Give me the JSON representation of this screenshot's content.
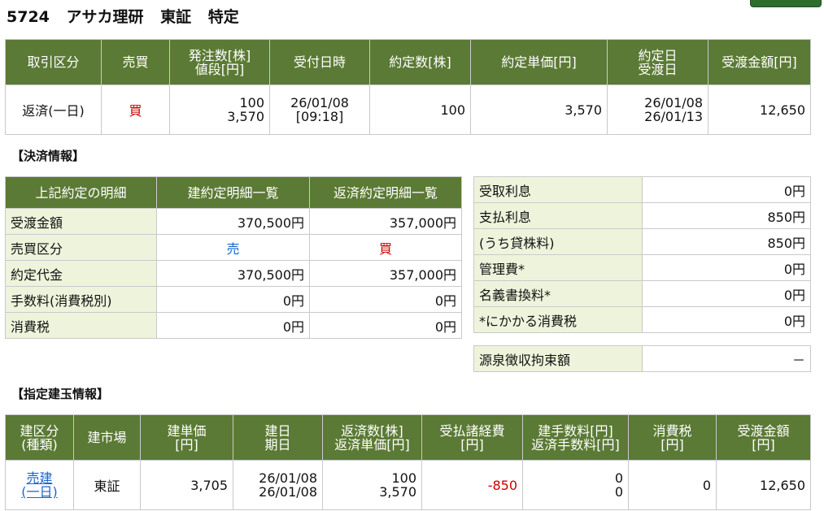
{
  "header": {
    "code": "5724",
    "name": "アサカ理研",
    "market": "東証",
    "account": "特定"
  },
  "order": {
    "headers": [
      "取引区分",
      "売買",
      "発注数[株]\n値段[円]",
      "受付日時",
      "約定数[株]",
      "約定単価[円]",
      "約定日\n受渡日",
      "受渡金額[円]"
    ],
    "row": {
      "type": "返済(一日)",
      "side": "買",
      "order_qty": "100",
      "order_price": "3,570",
      "recv_date": "26/01/08",
      "recv_time": "[09:18]",
      "exec_qty": "100",
      "exec_price": "3,570",
      "exec_date": "26/01/08",
      "deliv_date": "26/01/13",
      "amount": "12,650"
    }
  },
  "settlement": {
    "section_title": "【決済情報】",
    "headers": [
      "上記約定の明細",
      "建約定明細一覧",
      "返済約定明細一覧"
    ],
    "rows": [
      {
        "label": "受渡金額",
        "open": "370,500円",
        "close": "357,000円"
      },
      {
        "label": "売買区分",
        "open": "売",
        "close": "買"
      },
      {
        "label": "約定代金",
        "open": "370,500円",
        "close": "357,000円"
      },
      {
        "label": "手数料(消費税別)",
        "open": "0円",
        "close": "0円"
      },
      {
        "label": "消費税",
        "open": "0円",
        "close": "0円"
      }
    ]
  },
  "fees": {
    "rows": [
      {
        "label": "受取利息",
        "value": "0円"
      },
      {
        "label": "支払利息",
        "value": "850円"
      },
      {
        "label": "(うち貸株料)",
        "value": "850円"
      },
      {
        "label": "管理費*",
        "value": "0円"
      },
      {
        "label": "名義書換料*",
        "value": "0円"
      },
      {
        "label": "*にかかる消費税",
        "value": "0円"
      }
    ],
    "withholding": {
      "label": "源泉徴収拘束額",
      "value": "－"
    }
  },
  "positions": {
    "section_title": "【指定建玉情報】",
    "headers": [
      "建区分\n(種類)",
      "建市場",
      "建単価\n[円]",
      "建日\n期日",
      "返済数[株]\n返済単価[円]",
      "受払諸経費\n[円]",
      "建手数料[円]\n返済手数料[円]",
      "消費税\n[円]",
      "受渡金額\n[円]"
    ],
    "row": {
      "kind_1": "売建",
      "kind_2": "(一日)",
      "market": "東証",
      "open_price": "3,705",
      "open_date": "26/01/08",
      "due_date": "26/01/08",
      "close_qty": "100",
      "close_price": "3,570",
      "expenses": "-850",
      "open_fee": "0",
      "close_fee": "0",
      "tax": "0",
      "amount": "12,650"
    }
  },
  "colors": {
    "header_bg": "#5b7a35",
    "label_bg": "#eef4dc",
    "buy": "#cc0000",
    "sell": "#1a66cc"
  }
}
